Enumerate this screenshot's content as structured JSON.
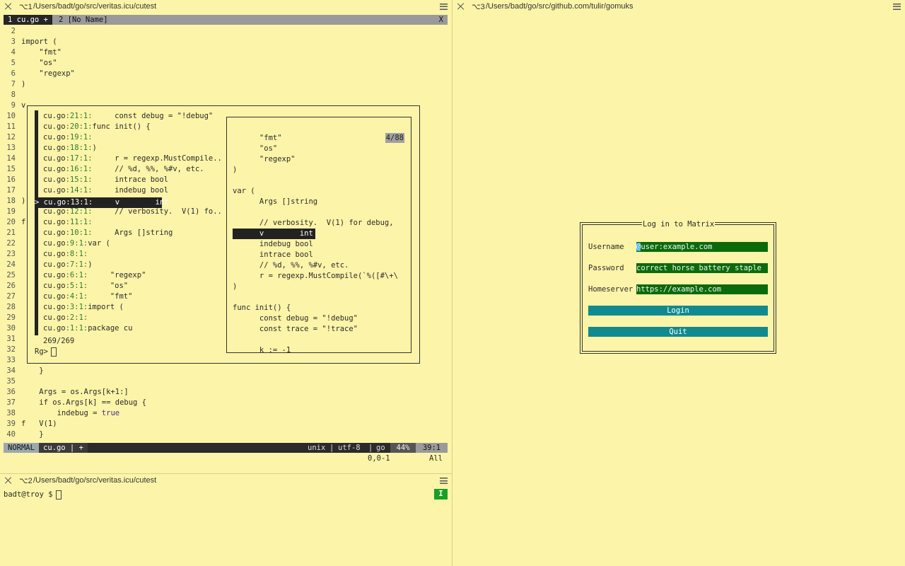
{
  "panes": {
    "top_left": {
      "num": "⌥1",
      "path": "/Users/badt/go/src/veritas.icu/cutest"
    },
    "bottom_left": {
      "num": "⌥2",
      "path": "/Users/badt/go/src/veritas.icu/cutest"
    },
    "right": {
      "num": "⌥3",
      "path": "/Users/badt/go/src/github.com/tulir/gomuks"
    }
  },
  "tabs": {
    "tab1": "1 cu.go +",
    "tab2": "2 [No Name]",
    "close": "X"
  },
  "editor_lines": [
    {
      "n": "2",
      "t": ""
    },
    {
      "n": "3",
      "t": "import ("
    },
    {
      "n": "4",
      "t": "    \"fmt\""
    },
    {
      "n": "5",
      "t": "    \"os\""
    },
    {
      "n": "6",
      "t": "    \"regexp\""
    },
    {
      "n": "7",
      "t": ")"
    },
    {
      "n": "8",
      "t": ""
    },
    {
      "n": "9",
      "t": "v"
    },
    {
      "n": "10",
      "t": ""
    },
    {
      "n": "11",
      "t": ""
    },
    {
      "n": "12",
      "t": ""
    },
    {
      "n": "13",
      "t": ""
    },
    {
      "n": "14",
      "t": ""
    },
    {
      "n": "15",
      "t": ""
    },
    {
      "n": "16",
      "t": ""
    },
    {
      "n": "17",
      "t": ""
    },
    {
      "n": "18",
      "t": ")"
    },
    {
      "n": "19",
      "t": ""
    },
    {
      "n": "20",
      "t": "f"
    },
    {
      "n": "21",
      "t": ""
    },
    {
      "n": "22",
      "t": ""
    },
    {
      "n": "23",
      "t": ""
    },
    {
      "n": "24",
      "t": ""
    },
    {
      "n": "25",
      "t": ""
    },
    {
      "n": "26",
      "t": ""
    },
    {
      "n": "27",
      "t": ""
    },
    {
      "n": "28",
      "t": ""
    },
    {
      "n": "29",
      "t": ""
    },
    {
      "n": "30",
      "t": ""
    },
    {
      "n": "31",
      "t": ""
    },
    {
      "n": "32",
      "t": ""
    },
    {
      "n": "33",
      "t": ""
    },
    {
      "n": "34",
      "t": "    }"
    },
    {
      "n": "35",
      "t": ""
    },
    {
      "n": "36",
      "t": "    Args = os.Args[k+1:]"
    },
    {
      "n": "37",
      "t": "    if os.Args[k] == debug {"
    },
    {
      "n": "38",
      "t": "        indebug = "
    },
    {
      "n": "39",
      "t": "f   V(1)"
    },
    {
      "n": "40",
      "t": "    }"
    }
  ],
  "true_kw": "true",
  "results": [
    {
      "file": "cu.go",
      "loc": ":21:1:",
      "text": "     const debug = \"!debug\""
    },
    {
      "file": "cu.go",
      "loc": ":20:1:",
      "text": "func init() {"
    },
    {
      "file": "cu.go",
      "loc": ":19:1:",
      "text": ""
    },
    {
      "file": "cu.go",
      "loc": ":18:1:",
      "text": ")"
    },
    {
      "file": "cu.go",
      "loc": ":17:1:",
      "text": "     r = regexp.MustCompile.."
    },
    {
      "file": "cu.go",
      "loc": ":16:1:",
      "text": "     // %d, %%, %#v, etc."
    },
    {
      "file": "cu.go",
      "loc": ":15:1:",
      "text": "     intrace bool"
    },
    {
      "file": "cu.go",
      "loc": ":14:1:",
      "text": "     indebug bool"
    },
    {
      "file": "cu.go",
      "loc": ":13:1:",
      "text": "     v        int"
    },
    {
      "file": "cu.go",
      "loc": ":12:1:",
      "text": "     // verbosity.  V(1) fo.."
    },
    {
      "file": "cu.go",
      "loc": ":11:1:",
      "text": ""
    },
    {
      "file": "cu.go",
      "loc": ":10:1:",
      "text": "     Args []string"
    },
    {
      "file": "cu.go",
      "loc": ":9:1:",
      "text": "var ("
    },
    {
      "file": "cu.go",
      "loc": ":8:1:",
      "text": ""
    },
    {
      "file": "cu.go",
      "loc": ":7:1:",
      "text": ")"
    },
    {
      "file": "cu.go",
      "loc": ":6:1:",
      "text": "     \"regexp\""
    },
    {
      "file": "cu.go",
      "loc": ":5:1:",
      "text": "     \"os\""
    },
    {
      "file": "cu.go",
      "loc": ":4:1:",
      "text": "     \"fmt\""
    },
    {
      "file": "cu.go",
      "loc": ":3:1:",
      "text": "import ("
    },
    {
      "file": "cu.go",
      "loc": ":2:1:",
      "text": ""
    },
    {
      "file": "cu.go",
      "loc": ":1:1:",
      "text": "package cu"
    }
  ],
  "selected_result": "> cu.go:13:1:     v        int",
  "result_count": "269/269",
  "prompt": "Rg>",
  "preview_counter": "4/88",
  "preview_lines": [
    "      \"fmt\"",
    "      \"os\"",
    "      \"regexp\"",
    ")",
    "",
    "var (",
    "      Args []string",
    "",
    "      // verbosity.  V(1) for debug,",
    "      v        int",
    "      indebug bool",
    "      intrace bool",
    "      // %d, %%, %#v, etc.",
    "      r = regexp.MustCompile(`%([#\\+\\",
    ")",
    "",
    "func init() {",
    "      const debug = \"!debug\"",
    "      const trace = \"!trace\"",
    "",
    "      k := -1"
  ],
  "statusline": {
    "mode": "NORMAL",
    "file": "cu.go | +",
    "fileformat": "unix",
    "encoding": "utf-8",
    "filetype": "go",
    "percent": "44%",
    "position": "39:1",
    "ruler": "0,0-1",
    "ruler_all": "All"
  },
  "shell": {
    "prompt": "badt@troy $",
    "badge": "I"
  },
  "login": {
    "title": "Log in to Matrix",
    "username_label": "Username",
    "username_value": "@user:example.com",
    "password_label": "Password",
    "password_value": "correct horse battery staple",
    "homeserver_label": "Homeserver",
    "homeserver_value": "https://example.com",
    "login_button": "Login",
    "quit_button": "Quit"
  }
}
